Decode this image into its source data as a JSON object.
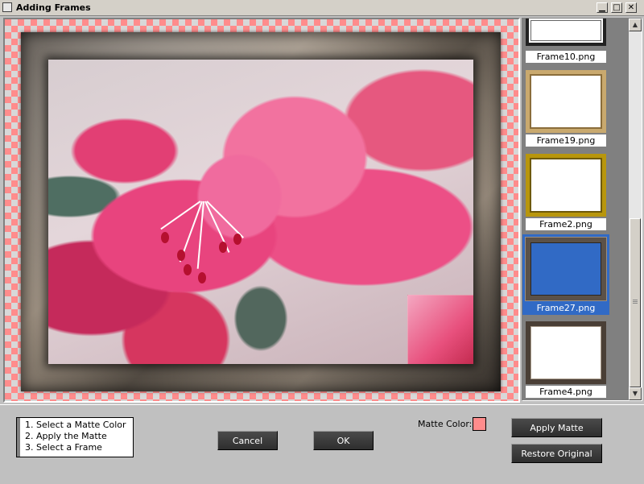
{
  "window": {
    "title": "Adding Frames",
    "controls": {
      "minimize": "▁",
      "maximize": "□",
      "close": "✕"
    }
  },
  "thumbnails": {
    "items": [
      {
        "label": "Frame10.png",
        "style": "white-black",
        "selected": false
      },
      {
        "label": "Frame19.png",
        "style": "white-gold",
        "selected": false
      },
      {
        "label": "Frame2.png",
        "style": "white-goldthick",
        "selected": false
      },
      {
        "label": "Frame27.png",
        "style": "blue-marble",
        "selected": true
      },
      {
        "label": "Frame4.png",
        "style": "white-marble",
        "selected": false
      }
    ],
    "scroll_up_icon": "▲",
    "scroll_down_icon": "▼"
  },
  "steps": [
    "1.  Select a Matte Color",
    "2.  Apply the Matte",
    "3.  Select a Frame"
  ],
  "buttons": {
    "cancel": "Cancel",
    "ok": "OK",
    "apply_matte": "Apply Matte",
    "restore_original": "Restore Original"
  },
  "matte": {
    "label": "Matte Color:",
    "color": "#ff8c8c"
  },
  "colors": {
    "selection": "#316ac5",
    "matte_checker_a": "#ff8c8c",
    "matte_checker_b": "#d8d8d8"
  }
}
